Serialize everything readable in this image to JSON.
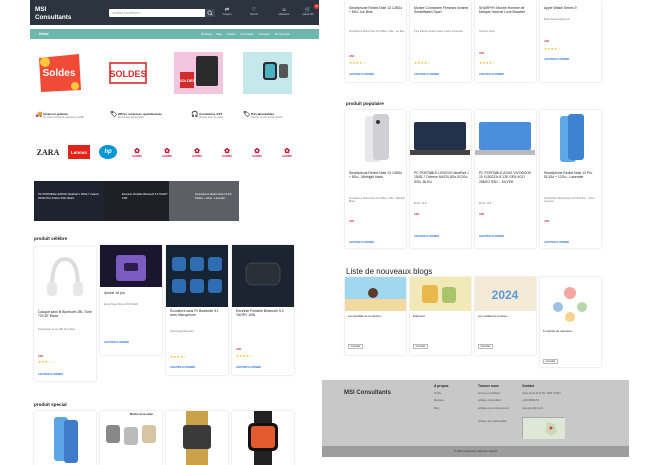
{
  "header": {
    "brand": "MSI\nConsultants",
    "search_placeholder": "Veuillez rechercher...",
    "icons": [
      {
        "name": "coupon-icon",
        "label": "Coupon"
      },
      {
        "name": "heart-icon",
        "label": "favoris"
      },
      {
        "name": "user-icon",
        "label": "utilisateur"
      },
      {
        "name": "cart-icon",
        "label": "panier\n$0",
        "badge": "0"
      }
    ]
  },
  "nav": {
    "home": "Home",
    "links": [
      "Boutique",
      "Blog",
      "Contact",
      "Commande",
      "Comparer",
      "Se connecter"
    ]
  },
  "features": [
    {
      "title": "livraison gratuite",
      "sub": "Sur toute commande supérieure à 100$"
    },
    {
      "title": "Offres surprises quotidiennes",
      "sub": "Économisez jusqu'à 25%"
    },
    {
      "title": "Assistance 24/7",
      "sub": "Achetez avec un expert"
    },
    {
      "title": "Prix abordables",
      "sub": "Obtenez un prix d'usine directe"
    }
  ],
  "brands": [
    "ZARA",
    "Lenovo",
    "hp",
    "HUAWEI",
    "HUAWEI",
    "HUAWEI",
    "HUAWEI",
    "HUAWEI",
    "HUAWEI"
  ],
  "carousel": [
    "PC PORTABLE LENOVO IdeaPad 1 15IGL7 Celeron N4020 8Go 512Go SSD -BLEU",
    "Enceinte Portable Bluetooth 5.0 TAGRY 10W",
    "Smartphone Redmi Note 13 Pro 512Go + 12Go - Lavender"
  ],
  "popular_section": "produit célèbre",
  "popular": [
    {
      "name": "Casque sans fil Bluetooth JBL Tune 720 BT Blanc",
      "desc": "Technologie de son:JBL Pure Bass",
      "cart": "AJOUTER AU PANIER"
    },
    {
      "name": "Iphone 16 pro",
      "desc": "Ecran Super Retina XDR OLED",
      "cart": "AJOUTER AU PANIER"
    },
    {
      "name": "Écouteurs sans Fil Bluetooth 5.1 avec Microphone",
      "desc": "Technologie Bluetooth",
      "cart": "AJOUTER AU PANIER"
    },
    {
      "name": "Enceinte Portable Bluetooth 5.0 TAGRY 10W",
      "desc": "",
      "cart": "AJOUTER AU PANIER"
    }
  ],
  "special_section": "produit special",
  "special_banner": "Montre de la santé",
  "top_right": [
    {
      "name": "Smartphone Redmi Note 13 128Go + 8Go -Ice Blue",
      "desc": "Smartphone Redmi Note 13 128Go + 8Go - Ice Blue",
      "cart": "AJOUTER AU PANIER"
    },
    {
      "name": "Montre Connectée Femmes homme SmartWatch Sport",
      "desc": "Type d'Écran tactile couleur montre connectée",
      "cart": "AJOUTER AU PANIER"
    },
    {
      "name": "SHARPHY Montre Homme de Marque Haut de Luxe Bracelet",
      "desc": "Hommes Sport",
      "cart": "AJOUTER AU PANIER"
    },
    {
      "name": "Apple Watch Series 9",
      "desc": "Écran Retina Always-On",
      "cart": "AJOUTER AU PANIER"
    }
  ],
  "popular2_section": "produit populaire",
  "popular2": [
    {
      "name": "Smartphone Redmi Note 13 128Go + 8Go - Midnight black",
      "desc": "Smartphone Redmi Note 13 128Go + 8Go - Midnight Black",
      "cart": "AJOUTER AU PANIER"
    },
    {
      "name": "PC PORTABLE LENOVO IdeaPad 1 15IGL7 Celeron N4020 8Go 512Go SSD -BLEU",
      "desc": "Écran: 15,6\"",
      "cart": "AJOUTER AU PANIER"
    },
    {
      "name": "PC PORTABLE ASUS VIVOBOOK 15 X1502ZA i3 12E GEN 4GO 256GO SSD – SILVER",
      "desc": "Écran: 15,6\"",
      "cart": "AJOUTER AU PANIER"
    },
    {
      "name": "Smartphone Redmi Note 13 Pro 512Go + 12Go - Lavender",
      "desc": "Smartphone Redmi Note 13 Pro 512Go + 12Go - Lavender",
      "cart": "AJOUTER AU PANIER"
    }
  ],
  "price_labels": [
    "ASD",
    "ASD",
    "ASD",
    "ASD"
  ],
  "blogs_section": "Liste de nouveaux blogs",
  "blogs": [
    {
      "title": "Les bienfaits de la marche...",
      "btn": "Consulter"
    },
    {
      "title": "Equiment",
      "btn": "Consulter"
    },
    {
      "title": "Les meilleures montres...",
      "btn": "Consulter"
    },
    {
      "title": "5 endroits de vacances...",
      "btn": "Consulter"
    }
  ],
  "footer": {
    "brand": "MSI Consultants",
    "col1_title": "À propos",
    "col1": [
      "Profile",
      "Boutique",
      "Blog"
    ],
    "col2_title": "Trouver nous",
    "col2": [
      "termes et conditions",
      "politique d'expedition",
      "politique de remboursement",
      "politique de confidentialité"
    ],
    "col3_title": "Contact",
    "col3": [
      "Cairo street 2131 FD, 3090 TOWN",
      "+216 99999-52",
      "www.gmail@msi.tn"
    ],
    "copyright": "© 2024 powered by salah ben laamid"
  }
}
